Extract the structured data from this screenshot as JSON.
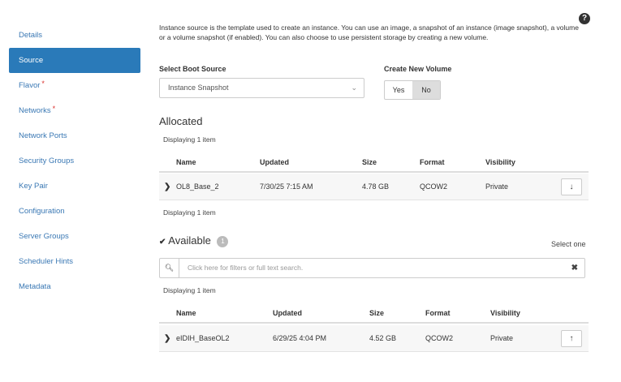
{
  "sidebar": {
    "items": [
      {
        "label": "Details",
        "required": false
      },
      {
        "label": "Source",
        "required": false
      },
      {
        "label": "Flavor",
        "required": true
      },
      {
        "label": "Networks",
        "required": true
      },
      {
        "label": "Network Ports",
        "required": false
      },
      {
        "label": "Security Groups",
        "required": false
      },
      {
        "label": "Key Pair",
        "required": false
      },
      {
        "label": "Configuration",
        "required": false
      },
      {
        "label": "Server Groups",
        "required": false
      },
      {
        "label": "Scheduler Hints",
        "required": false
      },
      {
        "label": "Metadata",
        "required": false
      }
    ],
    "required_marker": "*"
  },
  "help_glyph": "?",
  "intro": "Instance source is the template used to create an instance. You can use an image, a snapshot of an instance (image snapshot), a volume or a volume snapshot (if enabled). You can also choose to use persistent storage by creating a new volume.",
  "boot_source": {
    "label": "Select Boot Source",
    "value": "Instance Snapshot",
    "chevron": "⌄"
  },
  "new_volume": {
    "label": "Create New Volume",
    "yes": "Yes",
    "no": "No",
    "selected": "No"
  },
  "allocated": {
    "title": "Allocated",
    "count_top": "Displaying 1 item",
    "count_bottom": "Displaying 1 item",
    "columns": [
      "Name",
      "Updated",
      "Size",
      "Format",
      "Visibility"
    ],
    "rows": [
      {
        "name": "OL8_Base_2",
        "updated": "7/30/25 7:15 AM",
        "size": "4.78 GB",
        "format": "QCOW2",
        "visibility": "Private",
        "action": "↓"
      }
    ]
  },
  "available": {
    "title": "Available",
    "badge": "1",
    "select_hint": "Select one",
    "search_placeholder": "Click here for filters or full text search.",
    "clear": "✖",
    "count": "Displaying 1 item",
    "columns": [
      "Name",
      "Updated",
      "Size",
      "Format",
      "Visibility"
    ],
    "rows": [
      {
        "name": "eIDIH_BaseOL2",
        "updated": "6/29/25 4:04 PM",
        "size": "4.52 GB",
        "format": "QCOW2",
        "visibility": "Private",
        "action": "↑"
      }
    ]
  },
  "colors": {
    "accent": "#2a7ab9",
    "link": "#3a78b4",
    "required": "#d9302c"
  }
}
